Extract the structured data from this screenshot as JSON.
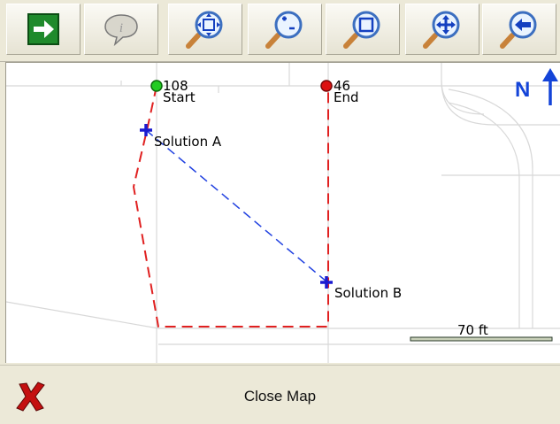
{
  "toolbar": {
    "buttons": [
      {
        "icon": "arrow-right-icon"
      },
      {
        "icon": "info-balloon-icon"
      },
      {
        "icon": "zoom-extent-icon"
      },
      {
        "icon": "zoom-in-out-icon"
      },
      {
        "icon": "zoom-window-icon"
      },
      {
        "icon": "pan-icon"
      },
      {
        "icon": "back-icon"
      }
    ]
  },
  "map": {
    "start": {
      "id": "108",
      "label": "Start",
      "color": "#22cc22"
    },
    "end": {
      "id": "46",
      "label": "End",
      "color": "#dd1111"
    },
    "solution_a": {
      "label": "Solution A",
      "color": "#1a1ad0"
    },
    "solution_b": {
      "label": "Solution B",
      "color": "#1a1ad0"
    },
    "route_color": "#e02020",
    "connector_color": "#2040e0",
    "north_label": "N",
    "scale_label": "70 ft"
  },
  "bottom": {
    "close_label": "Close Map",
    "close_icon": "red-x-icon"
  }
}
